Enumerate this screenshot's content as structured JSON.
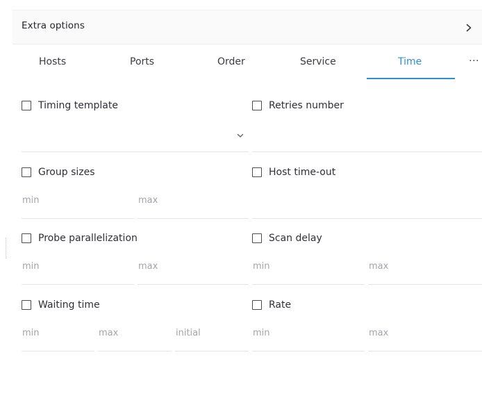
{
  "header": {
    "title": "Extra options"
  },
  "tabs": [
    {
      "label": "Hosts"
    },
    {
      "label": "Ports"
    },
    {
      "label": "Order"
    },
    {
      "label": "Service"
    },
    {
      "label": "Time",
      "active": true
    }
  ],
  "tabs_more": "···",
  "options": {
    "timing_template": {
      "label": "Timing template",
      "checked": false
    },
    "retries_number": {
      "label": "Retries number",
      "checked": false
    },
    "group_sizes": {
      "label": "Group sizes",
      "checked": false,
      "min_placeholder": "min",
      "max_placeholder": "max"
    },
    "host_timeout": {
      "label": "Host time-out",
      "checked": false
    },
    "probe_parallelization": {
      "label": "Probe parallelization",
      "checked": false,
      "min_placeholder": "min",
      "max_placeholder": "max"
    },
    "scan_delay": {
      "label": "Scan delay",
      "checked": false,
      "min_placeholder": "min",
      "max_placeholder": "max"
    },
    "waiting_time": {
      "label": "Waiting time",
      "checked": false,
      "min_placeholder": "min",
      "max_placeholder": "max",
      "initial_placeholder": "initial"
    },
    "rate": {
      "label": "Rate",
      "checked": false,
      "min_placeholder": "min",
      "max_placeholder": "max"
    }
  },
  "colors": {
    "accent": "#2b8fd6",
    "text": "#2f2f35",
    "placeholder": "#a4a4aa",
    "divider": "#e4e4e8",
    "header_bg": "#fafafb"
  },
  "icons": {
    "header_chevron": "chevron-right-icon",
    "select_chevron": "chevron-down-icon",
    "more": "more-horizontal-icon"
  }
}
